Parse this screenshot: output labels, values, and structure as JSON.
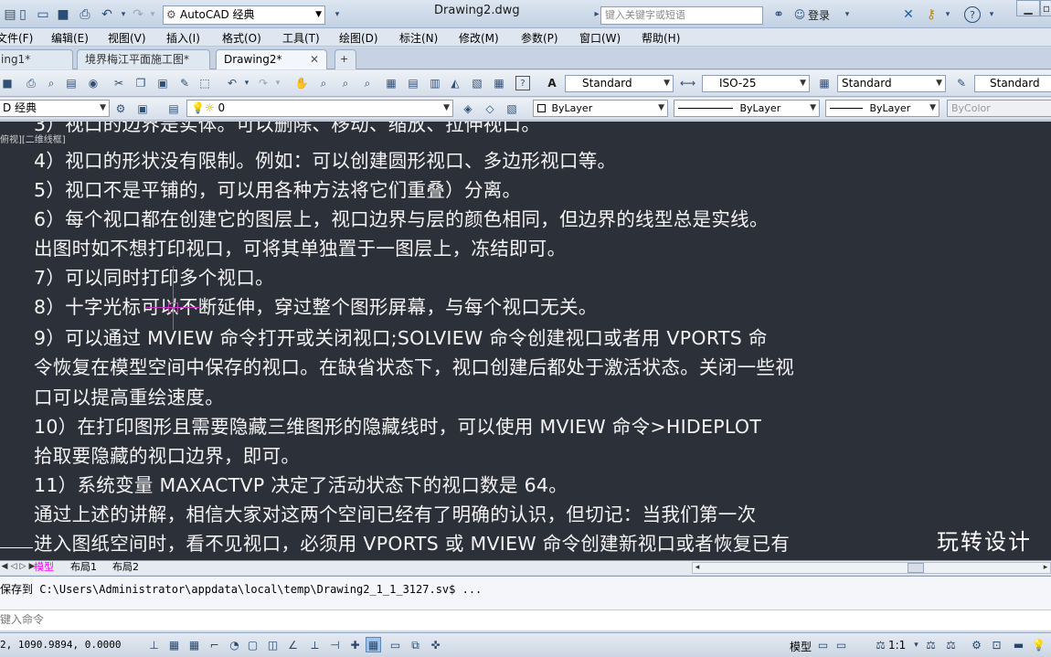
{
  "titlebar": {
    "workspace": "AutoCAD 经典",
    "title": "Drawing2.dwg",
    "search_placeholder": "键入关键字或短语",
    "login": "登录",
    "help": "?"
  },
  "menu": [
    "文件(F)",
    "编辑(E)",
    "视图(V)",
    "插入(I)",
    "格式(O)",
    "工具(T)",
    "绘图(D)",
    "标注(N)",
    "修改(M)",
    "参数(P)",
    "窗口(W)",
    "帮助(H)"
  ],
  "file_tabs": [
    {
      "label": "ing1*"
    },
    {
      "label": "境界梅江平面施工图*"
    },
    {
      "label": "Drawing2*"
    }
  ],
  "toolbar1": {
    "text_style": "Standard",
    "dim_style": "ISO-25",
    "table_style": "Standard",
    "multileader_style": "Standard"
  },
  "toolbar2": {
    "workspace": "D 经典",
    "layer": "0",
    "color": "ByLayer",
    "linetype": "ByLayer",
    "lineweight": "ByLayer",
    "plotstyle": "ByColor"
  },
  "drawing": {
    "viewport_label": "俯视][二维线框]",
    "cut_line": "3）视口的边界是实体。可以删除、移动、缩放、拉伸视口。",
    "lines": [
      "4）视口的形状没有限制。例如：可以创建圆形视口、多边形视口等。",
      "5）视口不是平铺的，可以用各种方法将它们重叠）分离。",
      "6）每个视口都在创建它的图层上，视口边界与层的颜色相同，但边界的线型总是实线。",
      "出图时如不想打印视口，可将其单独置于一图层上，冻结即可。",
      "7）可以同时打印多个视口。",
      "8）十字光标可以不断延伸，穿过整个图形屏幕，与每个视口无关。",
      "9）可以通过  MVIEW 命令打开或关闭视口;SOLVIEW 命令创建视口或者用  VPORTS 命",
      "令恢复在模型空间中保存的视口。在缺省状态下，视口创建后都处于激活状态。关闭一些视",
      "口可以提高重绘速度。",
      "10）在打印图形且需要隐藏三维图形的隐藏线时，可以使用  MVIEW 命令>HIDEPLOT",
      "拾取要隐藏的视口边界，即可。",
      "11）系统变量  MAXACTVP 决定了活动状态下的视口数是  64。",
      "通过上述的讲解，相信大家对这两个空间已经有了明确的认识，但切记：当我们第一次",
      "进入图纸空间时，看不见视口，必须用  VPORTS 或  MVIEW 命令创建新视口或者恢复已有"
    ],
    "watermark": "玩转设计"
  },
  "layout_tabs": [
    "模型",
    "布局1",
    "布局2"
  ],
  "command": {
    "history": "保存到 C:\\Users\\Administrator\\appdata\\local\\temp\\Drawing2_1_1_3127.sv$ ...",
    "prompt": "键入命令"
  },
  "status": {
    "coords": "2, 1090.9894, 0.0000",
    "model": "模型",
    "scale": "1:1"
  }
}
